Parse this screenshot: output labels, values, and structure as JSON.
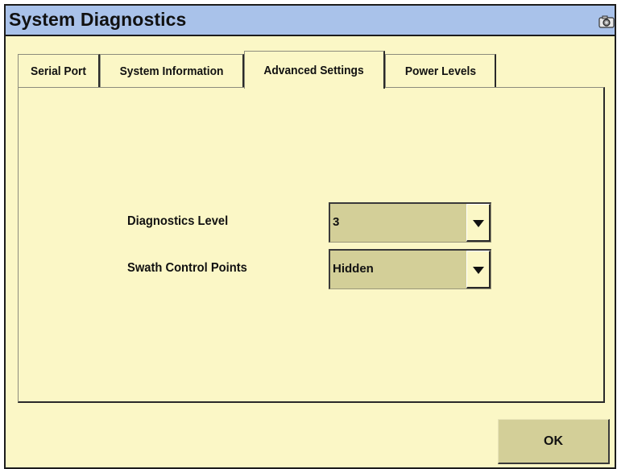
{
  "window": {
    "title": "System Diagnostics",
    "title_icon": "camera-icon"
  },
  "tabs": [
    {
      "label": "Serial Port",
      "active": false
    },
    {
      "label": "System Information",
      "active": false
    },
    {
      "label": "Advanced Settings",
      "active": true
    },
    {
      "label": "Power Levels",
      "active": false
    }
  ],
  "fields": {
    "diagnostics_level": {
      "label": "Diagnostics Level",
      "value": "3",
      "icon": "chevron-down-icon"
    },
    "swath_control_points": {
      "label": "Swath Control Points",
      "value": "Hidden",
      "icon": "chevron-down-icon"
    }
  },
  "actions": {
    "ok_label": "OK"
  },
  "colors": {
    "titlebar": "#a9c2ea",
    "background": "#fbf7c6",
    "control": "#d3cf98"
  }
}
